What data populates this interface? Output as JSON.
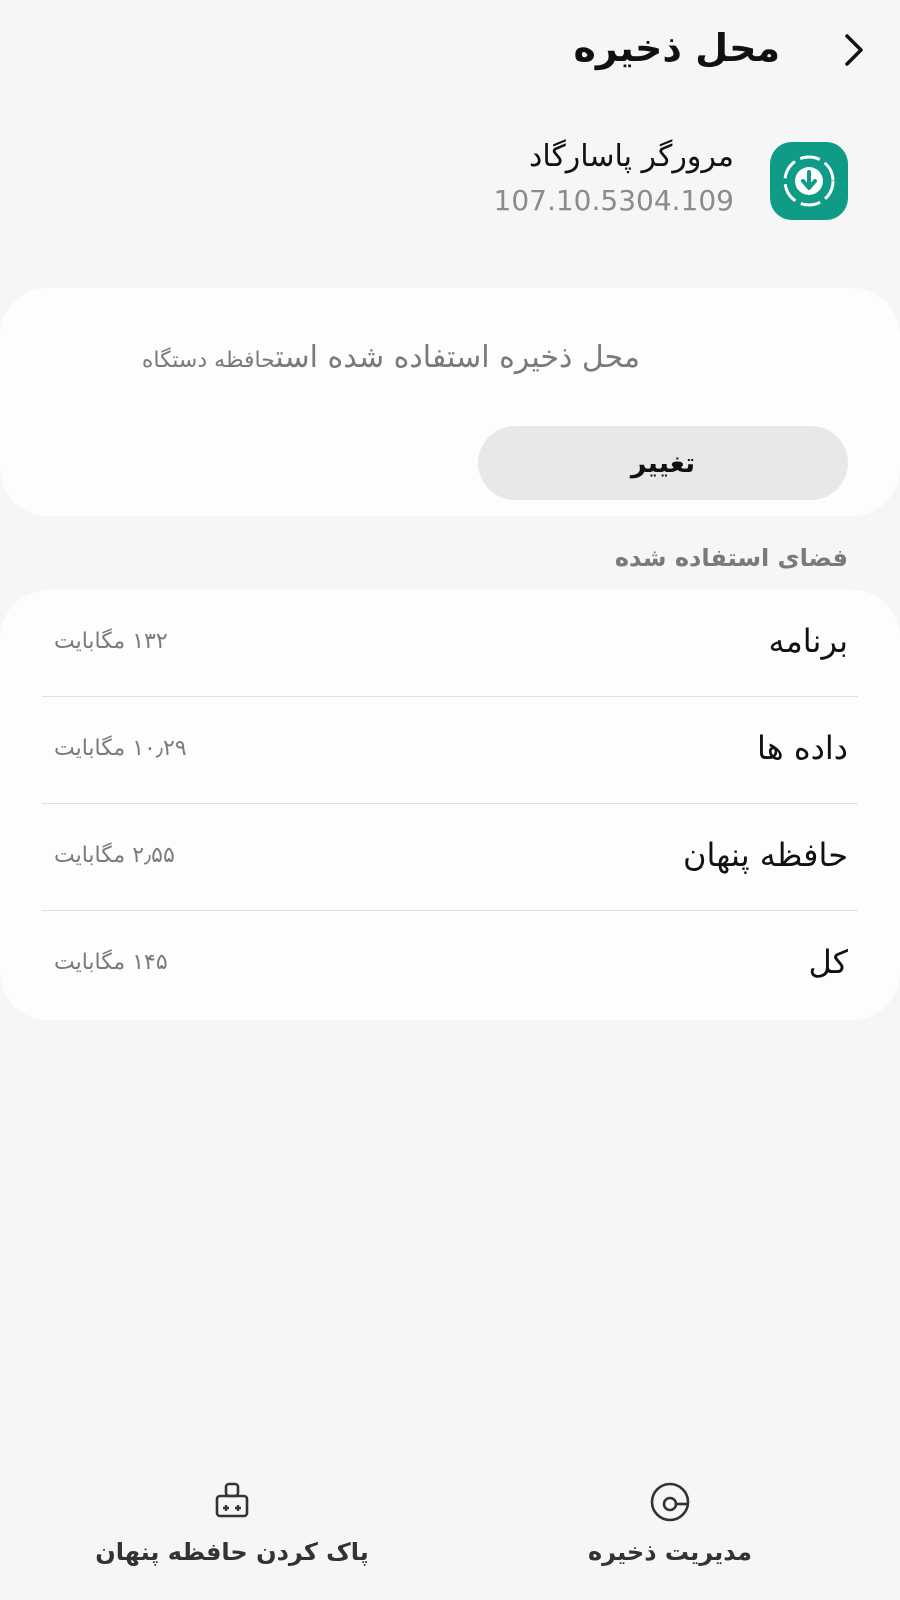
{
  "header": {
    "title": "محل ذخیره",
    "back_icon": "chevron-right-icon"
  },
  "app": {
    "name": "مرورگر پاسارگاد",
    "version": "107.10.5304.109",
    "icon": "download-icon",
    "icon_color": "#0e9c86"
  },
  "storage": {
    "location_text": "محل ذخیره استفاده شده است",
    "location_value": "حافظه دستگاه",
    "change_label": "تغییر"
  },
  "usage": {
    "section_title": "فضای استفاده شده",
    "rows": [
      {
        "label": "برنامه",
        "value": "۱۳۲ مگابایت"
      },
      {
        "label": "داده ها",
        "value": "۱۰٫۲۹ مگابایت"
      },
      {
        "label": "حافظه پنهان",
        "value": "۲٫۵۵ مگابایت"
      },
      {
        "label": "کل",
        "value": "۱۴۵ مگابایت"
      }
    ]
  },
  "bottom_bar": {
    "manage_label": "مدیریت ذخیره",
    "manage_icon": "storage-gauge-icon",
    "clear_label": "پاک کردن حافظه پنهان",
    "clear_icon": "broom-icon"
  }
}
